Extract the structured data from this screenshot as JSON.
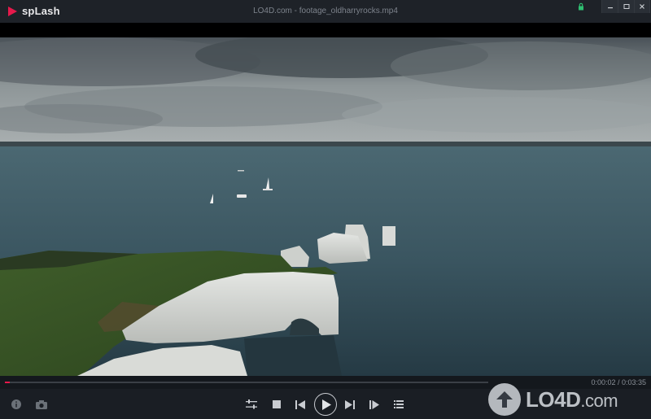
{
  "app": {
    "name": "spLash",
    "window_title": "LO4D.com - footage_oldharryrocks.mp4",
    "brand_color": "#e6194b"
  },
  "window_controls": {
    "items": [
      {
        "name": "lock",
        "icon": "lock-icon",
        "color": "#2fbf71"
      },
      {
        "name": "minimize",
        "icon": "minimize-icon"
      },
      {
        "name": "maximize",
        "icon": "maximize-icon"
      },
      {
        "name": "close",
        "icon": "close-icon"
      }
    ]
  },
  "playback": {
    "current_time": "0:00:02",
    "total_time": "0:03:35",
    "time_display": "0:00:02 / 0:03:35",
    "progress_fraction": 0.0093
  },
  "controls": {
    "left": [
      {
        "name": "info",
        "icon": "info-icon"
      },
      {
        "name": "snapshot",
        "icon": "camera-icon"
      }
    ],
    "center": [
      {
        "name": "equalizer",
        "icon": "sliders-icon"
      },
      {
        "name": "stop",
        "icon": "stop-icon"
      },
      {
        "name": "previous",
        "icon": "skip-back-icon"
      },
      {
        "name": "play",
        "icon": "play-icon"
      },
      {
        "name": "next",
        "icon": "skip-forward-icon"
      },
      {
        "name": "frame-step",
        "icon": "frame-step-icon"
      },
      {
        "name": "playlist",
        "icon": "playlist-icon"
      }
    ]
  },
  "watermark": {
    "text": "LO4D",
    "suffix": ".com"
  }
}
